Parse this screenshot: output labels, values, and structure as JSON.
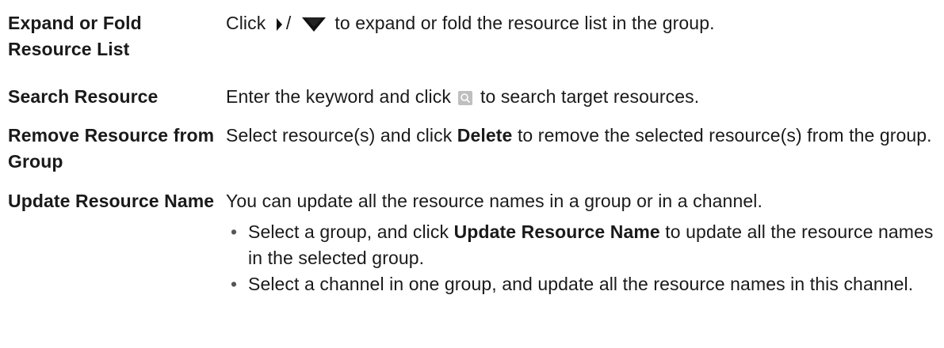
{
  "rows": [
    {
      "term": "Expand or Fold Resource List",
      "desc": {
        "prefix": "Click",
        "separator": "/",
        "suffix": "to expand or fold the resource list in the group.",
        "icons": [
          "caret-right-icon",
          "caret-down-icon"
        ]
      }
    },
    {
      "term": "Search Resource",
      "desc": {
        "prefix": "Enter the keyword and click",
        "suffix": "to search target resources.",
        "icons": [
          "search-icon"
        ]
      }
    },
    {
      "term": "Remove Resource from Group",
      "desc": {
        "prefix": "Select resource(s) and click",
        "bold": "Delete",
        "suffix": "to remove the selected resource(s) from the group."
      }
    },
    {
      "term": "Update Resource Name",
      "desc": {
        "intro": "You can update all the resource names in a group or in a channel.",
        "bullets": [
          {
            "prefix": "Select a group, and click",
            "bold": "Update Resource Name",
            "suffix": "to update all the resource names in the selected group."
          },
          {
            "text": "Select a channel in one group, and update all the resource names in this channel."
          }
        ]
      }
    }
  ],
  "bullet_char": "•",
  "colors": {
    "text": "#1a1a1a",
    "search_icon_bg": "#bfbfbf",
    "caret_fill": "#111111"
  }
}
